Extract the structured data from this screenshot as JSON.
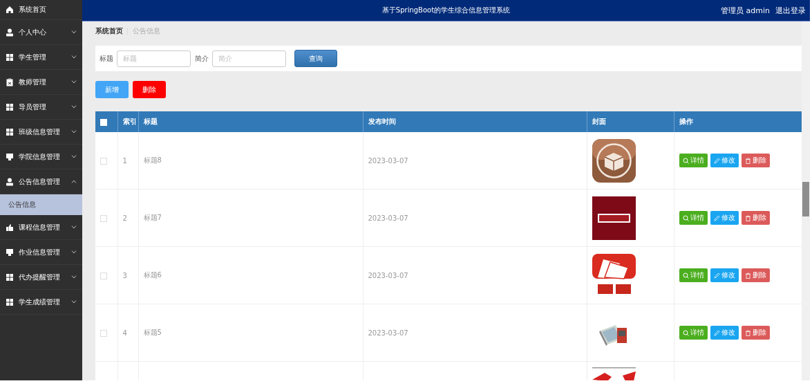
{
  "header": {
    "title": "基于SpringBoot的学生综合信息管理系统",
    "user": "管理员 admin",
    "logout": "退出登录"
  },
  "sidebar": {
    "items": [
      {
        "label": "系统首页",
        "kind": "link"
      },
      {
        "label": "个人中心",
        "kind": "menu",
        "expanded": false
      },
      {
        "label": "学生管理",
        "kind": "menu",
        "expanded": false
      },
      {
        "label": "教师管理",
        "kind": "menu",
        "expanded": false
      },
      {
        "label": "导员管理",
        "kind": "menu",
        "expanded": false
      },
      {
        "label": "班级信息管理",
        "kind": "menu",
        "expanded": false
      },
      {
        "label": "学院信息管理",
        "kind": "menu",
        "expanded": false
      },
      {
        "label": "公告信息管理",
        "kind": "menu",
        "expanded": true,
        "children": [
          {
            "label": "公告信息",
            "selected": true
          }
        ]
      },
      {
        "label": "课程信息管理",
        "kind": "menu",
        "expanded": false
      },
      {
        "label": "作业信息管理",
        "kind": "menu",
        "expanded": false
      },
      {
        "label": "代办提醒管理",
        "kind": "menu",
        "expanded": false
      },
      {
        "label": "学生成绩管理",
        "kind": "menu",
        "expanded": false
      }
    ]
  },
  "breadcrumb": [
    "系统首页",
    "公告信息"
  ],
  "search": {
    "fields": [
      {
        "label": "标题",
        "placeholder": "标题"
      },
      {
        "label": "简介",
        "placeholder": "简介"
      }
    ],
    "button": "查询"
  },
  "toolbar": [
    {
      "label": "新增",
      "kind": "add"
    },
    {
      "label": "删除",
      "kind": "delete"
    }
  ],
  "table": {
    "select_all_checked": false,
    "columns": [
      "索引",
      "标题",
      "发布时间",
      "封面",
      "操作"
    ],
    "rows": [
      {
        "checked": false,
        "index": "1",
        "title": "标题8",
        "time": "2023-03-07",
        "cover": {
          "kind": "picture"
        },
        "actions": [
          {
            "label": "详情",
            "kind": "detail"
          },
          {
            "label": "修改",
            "kind": "edit"
          },
          {
            "label": "删除",
            "kind": "delete"
          }
        ]
      },
      {
        "checked": false,
        "index": "2",
        "title": "标题7",
        "time": "2023-03-07",
        "cover": {
          "kind": "picture"
        },
        "actions": [
          {
            "label": "详情",
            "kind": "detail"
          },
          {
            "label": "修改",
            "kind": "edit"
          },
          {
            "label": "删除",
            "kind": "delete"
          }
        ]
      },
      {
        "checked": false,
        "index": "3",
        "title": "标题6",
        "time": "2023-03-07",
        "cover": {
          "kind": "picture"
        },
        "actions": [
          {
            "label": "详情",
            "kind": "detail"
          },
          {
            "label": "修改",
            "kind": "edit"
          },
          {
            "label": "删除",
            "kind": "delete"
          }
        ]
      },
      {
        "checked": false,
        "index": "4",
        "title": "标题5",
        "time": "2023-03-07",
        "cover": {
          "kind": "picture"
        },
        "actions": [
          {
            "label": "详情",
            "kind": "detail"
          },
          {
            "label": "修改",
            "kind": "edit"
          },
          {
            "label": "删除",
            "kind": "delete"
          }
        ]
      }
    ],
    "partial_row": {
      "cover": {
        "kind": "picture"
      }
    }
  }
}
